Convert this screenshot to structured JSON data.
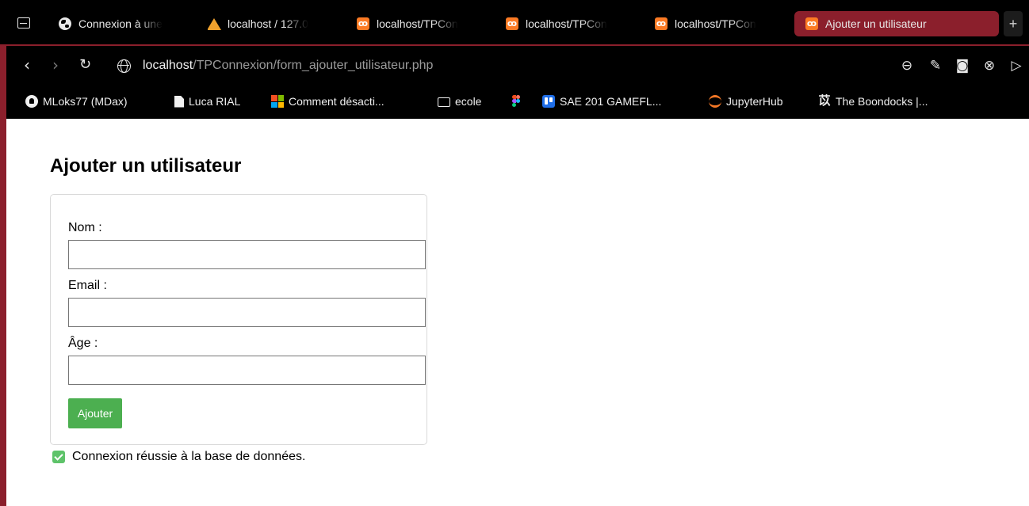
{
  "browser": {
    "tabs": [
      {
        "label": "Connexion à une",
        "icon": "globe-icon"
      },
      {
        "label": "localhost / 127.0",
        "icon": "phpmyadmin-icon"
      },
      {
        "label": "localhost/TPCon",
        "icon": "xampp-icon"
      },
      {
        "label": "localhost/TPCon",
        "icon": "xampp-icon"
      },
      {
        "label": "localhost/TPCon",
        "icon": "xampp-icon"
      },
      {
        "label": "Ajouter un utilisateur",
        "icon": "xampp-icon",
        "active": true
      }
    ],
    "new_tab_label": "+",
    "url_host": "localhost",
    "url_path": "/TPConnexion/form_ajouter_utilisateur.php",
    "bookmarks": [
      {
        "label": "MLoks77 (MDax)",
        "icon": "github-icon"
      },
      {
        "label": "Luca RIAL",
        "icon": "document-icon"
      },
      {
        "label": "Comment désacti...",
        "icon": "microsoft-icon"
      },
      {
        "label": "ecole",
        "icon": "folder-icon"
      },
      {
        "label": "",
        "icon": "figma-icon"
      },
      {
        "label": "SAE 201 GAMEFL...",
        "icon": "trello-icon"
      },
      {
        "label": "JupyterHub",
        "icon": "jupyter-icon"
      },
      {
        "label": "The Boondocks |...",
        "icon": "boondocks-icon"
      }
    ],
    "colors": {
      "accent": "#8b1f2c",
      "chrome": "#000000"
    }
  },
  "page": {
    "title": "Ajouter un utilisateur",
    "form": {
      "name_label": "Nom :",
      "name_value": "",
      "email_label": "Email :",
      "email_value": "",
      "age_label": "Âge :",
      "age_value": "",
      "submit_label": "Ajouter"
    },
    "status_message": "Connexion réussie à la base de données.",
    "colors": {
      "button": "#4caf50",
      "check": "#5ec36a"
    }
  }
}
